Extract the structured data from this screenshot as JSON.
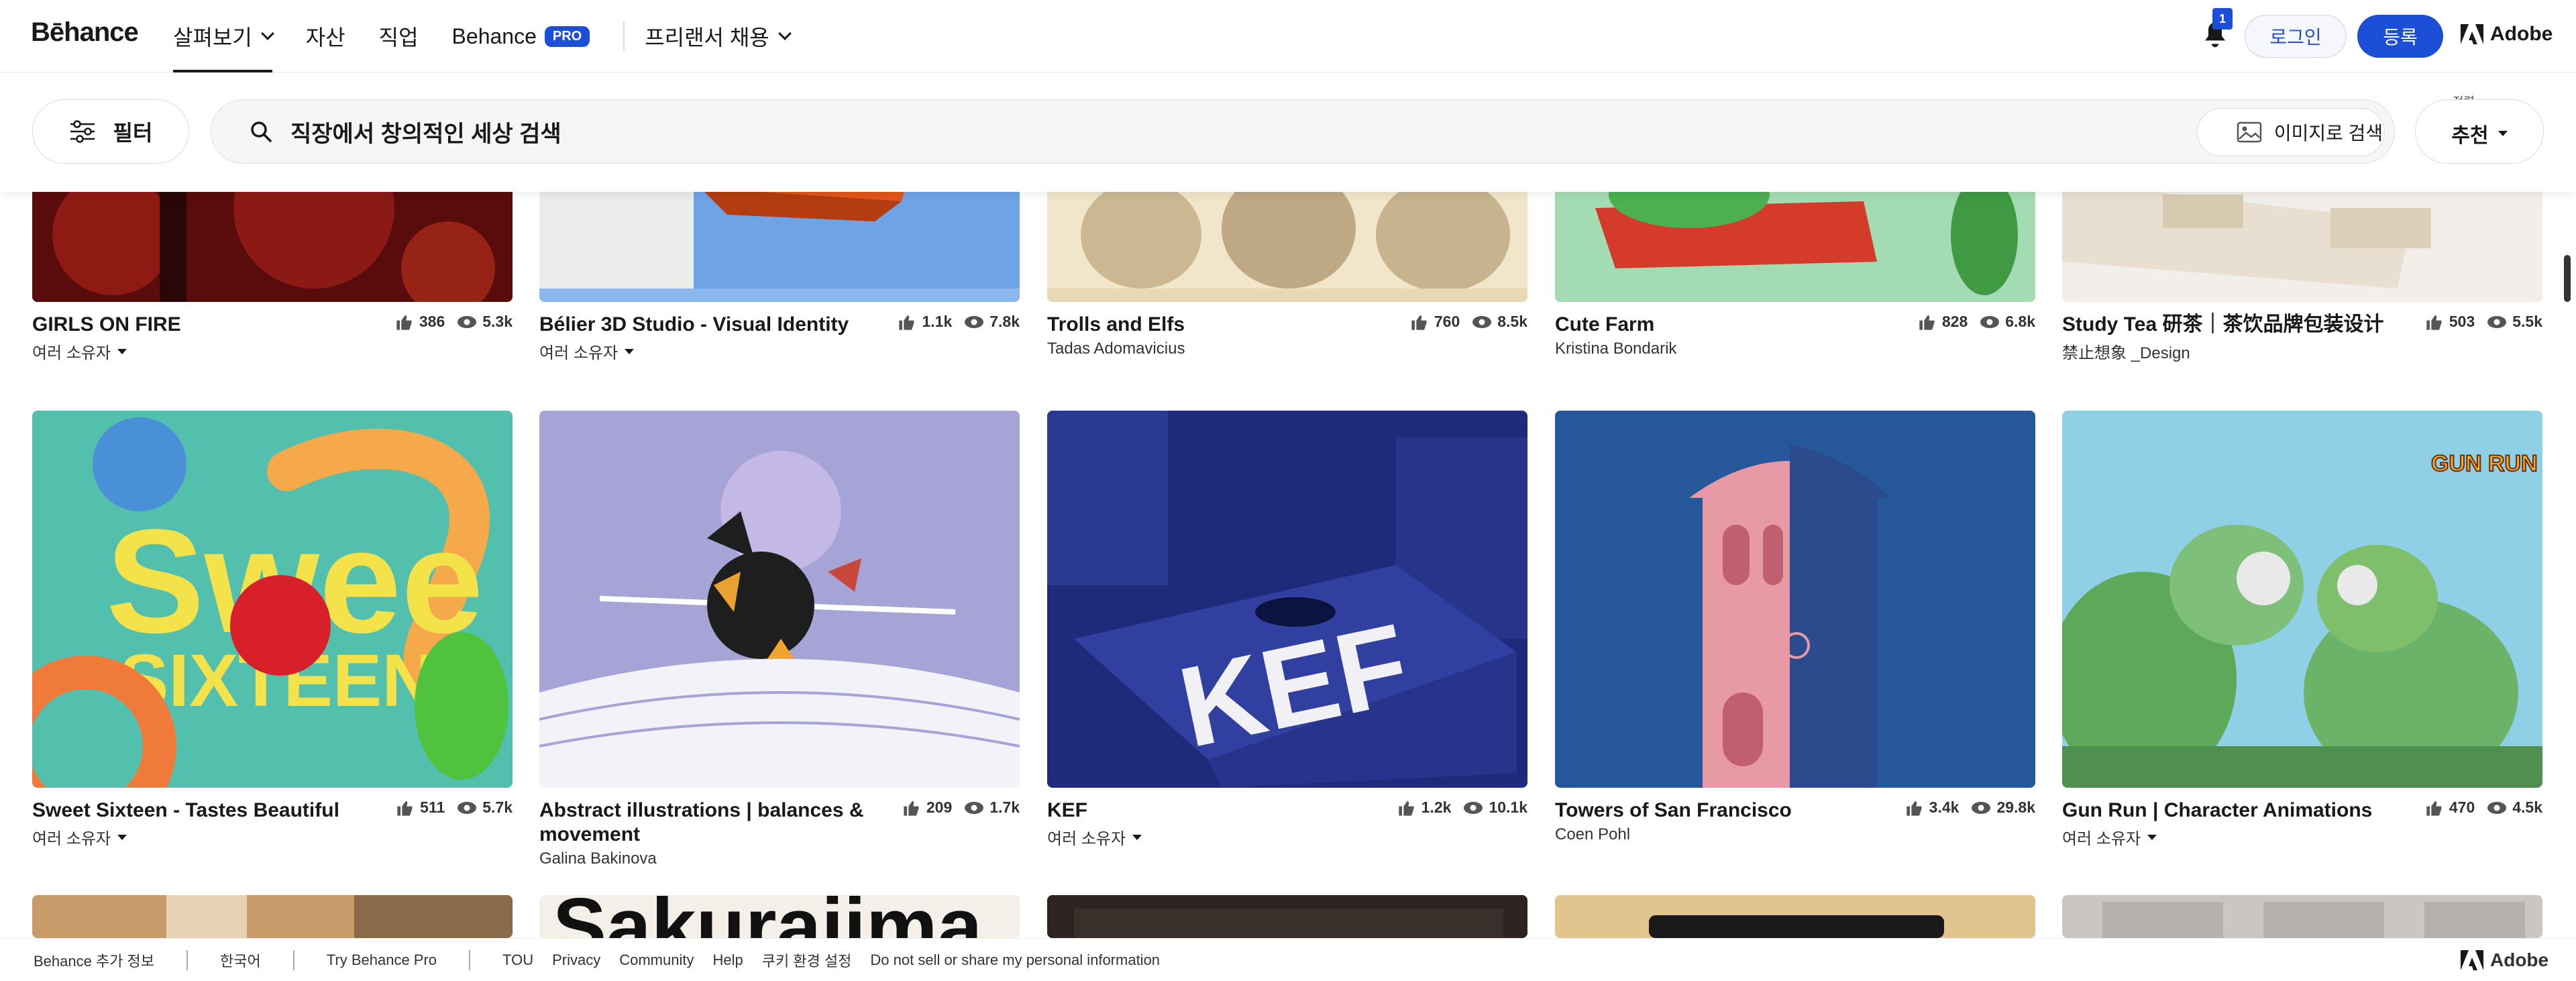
{
  "nav": {
    "logo": "Bēhance",
    "links": [
      {
        "label": "살펴보기",
        "active": true,
        "has_chevron": true
      },
      {
        "label": "자산"
      },
      {
        "label": "직업"
      },
      {
        "label": "Behance",
        "badge": "PRO"
      }
    ],
    "freelance": "프리랜서 채용",
    "notification_count": "1",
    "login": "로그인",
    "signup": "등록",
    "adobe": "Adobe"
  },
  "search": {
    "filter_label": "필터",
    "query": "직장에서 창의적인 세상 검색",
    "image_search": "이미지로 검색",
    "sort_caption": "정렬",
    "sort_value": "추천"
  },
  "row1": [
    {
      "title": "GIRLS ON FIRE",
      "owner": "여러 소유자",
      "owner_dropdown": true,
      "likes": "386",
      "views": "5.3k"
    },
    {
      "title": "Bélier 3D Studio - Visual Identity",
      "owner": "여러 소유자",
      "owner_dropdown": true,
      "likes": "1.1k",
      "views": "7.8k"
    },
    {
      "title": "Trolls and Elfs",
      "owner": "Tadas Adomavicius",
      "likes": "760",
      "views": "8.5k"
    },
    {
      "title": "Cute Farm",
      "owner": "Kristina Bondarik",
      "likes": "828",
      "views": "6.8k"
    },
    {
      "title": "Study Tea 研茶｜茶饮品牌包装设计",
      "owner": "禁止想象 _Design",
      "likes": "503",
      "views": "5.5k"
    }
  ],
  "row2": [
    {
      "title": "Sweet Sixteen - Tastes Beautiful",
      "owner": "여러 소유자",
      "owner_dropdown": true,
      "likes": "511",
      "views": "5.7k"
    },
    {
      "title": "Abstract illustrations | balances & movement",
      "owner": "Galina Bakinova",
      "likes": "209",
      "views": "1.7k"
    },
    {
      "title": "KEF",
      "owner": "여러 소유자",
      "owner_dropdown": true,
      "likes": "1.2k",
      "views": "10.1k"
    },
    {
      "title": "Towers of San Francisco",
      "owner": "Coen Pohl",
      "likes": "3.4k",
      "views": "29.8k"
    },
    {
      "title": "Gun Run | Character Animations",
      "owner": "여러 소유자",
      "owner_dropdown": true,
      "likes": "470",
      "views": "4.5k"
    }
  ],
  "artwork_text": {
    "sweet_big": "Swee",
    "sixteen": "SIXTEEN",
    "kef": "KEF",
    "gunrun": "GUN RUN",
    "sakura": "Sakuraiima"
  },
  "footer": {
    "more": "Behance 추가 정보",
    "lang": "한국어",
    "try_pro": "Try Behance Pro",
    "links": [
      "TOU",
      "Privacy",
      "Community",
      "Help",
      "쿠키 환경 설정",
      "Do not sell or share my personal information"
    ],
    "adobe": "Adobe"
  },
  "colors": {
    "accent": "#1d4ed8",
    "text": "#191919"
  }
}
